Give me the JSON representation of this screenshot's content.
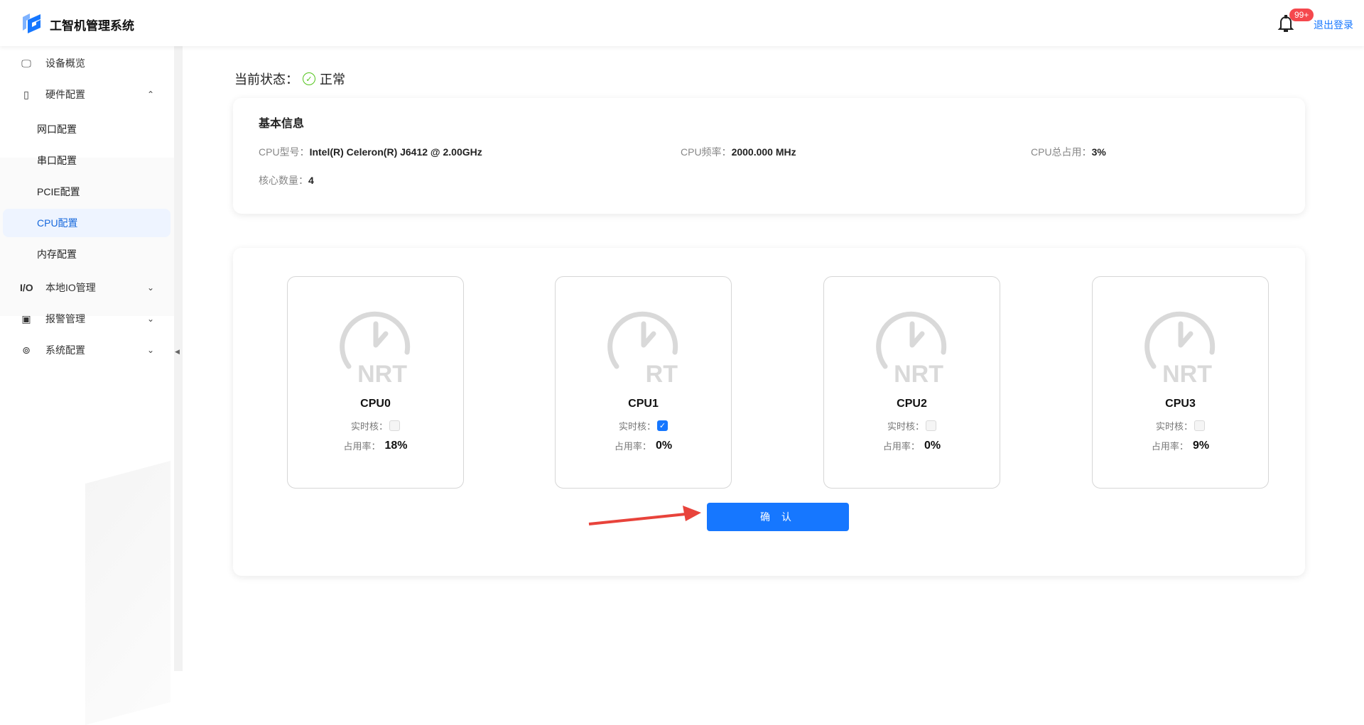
{
  "header": {
    "title": "工智机管理系统",
    "badge": "99+",
    "logout": "退出登录"
  },
  "sidebar": {
    "items": [
      {
        "label": "设备概览",
        "icon": "monitor-icon"
      },
      {
        "label": "硬件配置",
        "icon": "device-icon",
        "expanded": true
      },
      {
        "label": "本地IO管理",
        "icon": "io-icon"
      },
      {
        "label": "报警管理",
        "icon": "alarm-icon"
      },
      {
        "label": "系统配置",
        "icon": "settings-icon"
      }
    ],
    "sub_items": [
      "网口配置",
      "串口配置",
      "PCIE配置",
      "CPU配置",
      "内存配置"
    ],
    "active": "CPU配置"
  },
  "status": {
    "label": "当前状态：",
    "value": "正常"
  },
  "info": {
    "title": "基本信息",
    "model_label": "CPU型号：",
    "model": "Intel(R) Celeron(R) J6412 @ 2.00GHz",
    "freq_label": "CPU频率：",
    "freq": "2000.000 MHz",
    "usage_label": "CPU总占用：",
    "usage": "3%",
    "cores_label": "核心数量：",
    "cores": "4"
  },
  "cpus": [
    {
      "name": "CPU0",
      "type": "NRT",
      "realtime": false,
      "usage": "18%"
    },
    {
      "name": "CPU1",
      "type": "RT",
      "realtime": true,
      "usage": "0%"
    },
    {
      "name": "CPU2",
      "type": "NRT",
      "realtime": false,
      "usage": "0%"
    },
    {
      "name": "CPU3",
      "type": "NRT",
      "realtime": false,
      "usage": "9%"
    }
  ],
  "labels": {
    "realtime": "实时核：",
    "usage": "占用率："
  },
  "confirm": "确 认"
}
